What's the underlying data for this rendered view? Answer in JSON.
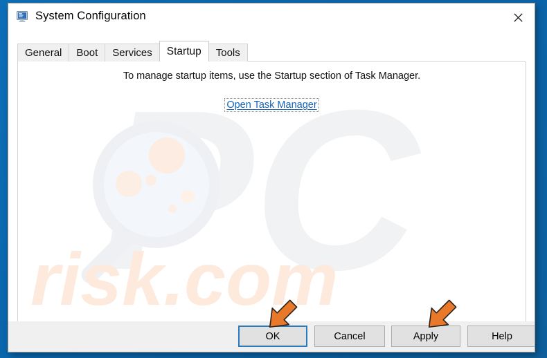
{
  "window": {
    "title": "System Configuration",
    "icon": "system-configuration-icon",
    "close_label": "✕"
  },
  "tabs": [
    {
      "label": "General",
      "active": false
    },
    {
      "label": "Boot",
      "active": false
    },
    {
      "label": "Services",
      "active": false
    },
    {
      "label": "Startup",
      "active": true
    },
    {
      "label": "Tools",
      "active": false
    }
  ],
  "content": {
    "instruction": "To manage startup items, use the Startup section of Task Manager.",
    "link_label": "Open Task Manager"
  },
  "buttons": [
    {
      "label": "OK",
      "default": true
    },
    {
      "label": "Cancel",
      "default": false
    },
    {
      "label": "Apply",
      "default": false
    },
    {
      "label": "Help",
      "default": false
    }
  ],
  "watermark": {
    "letters": "PC",
    "domain": "risk.com",
    "glass_color": "#eff1f5",
    "lens_color": "#f2f5fa",
    "germ_color": "#fdece1",
    "letter_color": "#f2f3f5",
    "domain_color": "#fdeadd"
  },
  "annotations": {
    "arrow_color": "#e8792a",
    "arrow_targets": [
      "OK",
      "Apply"
    ]
  },
  "colors": {
    "desktop": "#0b67ae",
    "accent": "#1464b4",
    "default_button_border": "#2a7ac0",
    "button_face": "#e1e1e1",
    "dialog_face": "#f0f0f0"
  }
}
